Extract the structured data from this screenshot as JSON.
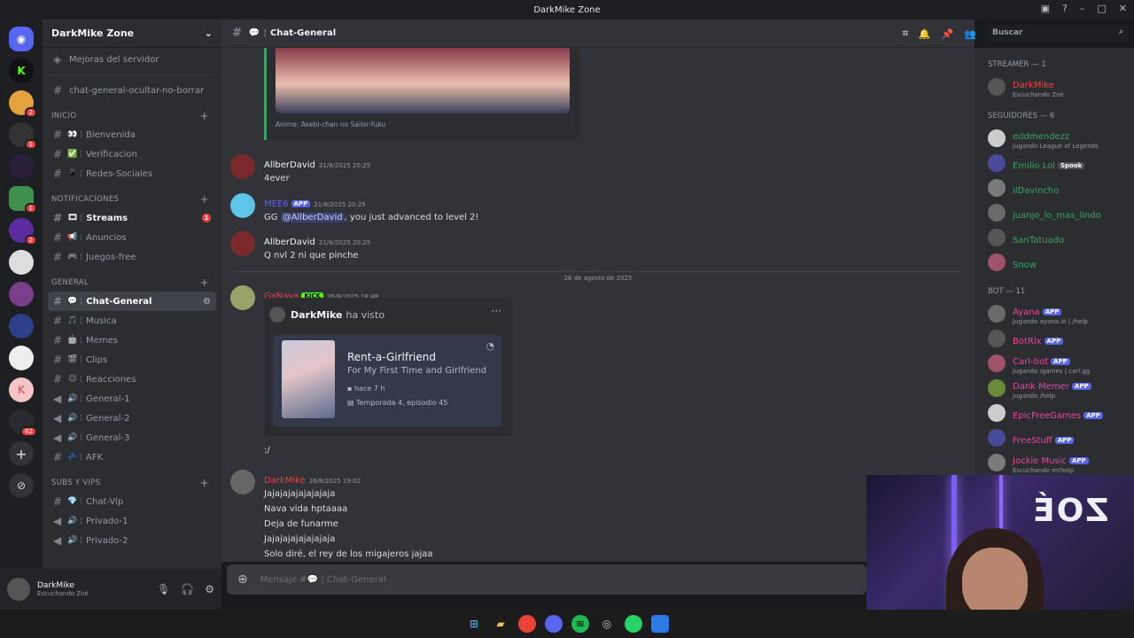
{
  "window": {
    "title": "DarkMike Zone"
  },
  "server_rail": {
    "badges": [
      "2",
      "1",
      "1",
      "2",
      "62"
    ]
  },
  "sidebar": {
    "server_name": "DarkMike Zone",
    "boost": "Mejoras del servidor",
    "top_channel": "chat-general-ocultar-no-borrar",
    "categories": [
      {
        "name": "INICIO",
        "channels": [
          {
            "emoji": "👀",
            "label": "Bienvenida"
          },
          {
            "emoji": "✅",
            "label": "Verificacion"
          },
          {
            "emoji": "📱",
            "label": "Redes-Sociales"
          }
        ]
      },
      {
        "name": "NOTIFICACIONES",
        "channels": [
          {
            "emoji": "🎞",
            "label": "Streams",
            "badge": "1"
          },
          {
            "emoji": "📢",
            "label": "Anuncios"
          },
          {
            "emoji": "🎮",
            "label": "Juegos-free"
          }
        ]
      },
      {
        "name": "GENERAL",
        "channels": [
          {
            "emoji": "💬",
            "label": "Chat-General"
          },
          {
            "emoji": "🎵",
            "label": "Musica"
          },
          {
            "emoji": "🤖",
            "label": "Memes"
          },
          {
            "emoji": "🎬",
            "label": "Clips"
          },
          {
            "emoji": "😊",
            "label": "Reacciones"
          },
          {
            "emoji": "🔊",
            "label": "General-1"
          },
          {
            "emoji": "🔊",
            "label": "General-2"
          },
          {
            "emoji": "🔊",
            "label": "General-3"
          },
          {
            "emoji": "💤",
            "label": "AFK"
          }
        ]
      },
      {
        "name": "SUBS Y VIPS",
        "channels": [
          {
            "emoji": "💎",
            "label": "Chat-Vip"
          },
          {
            "emoji": "🔊",
            "label": "Privado-1"
          },
          {
            "emoji": "🔊",
            "label": "Privado-2"
          }
        ]
      }
    ]
  },
  "user_panel": {
    "name": "DarkMike",
    "status": "Escuchando Zoé"
  },
  "chat": {
    "channel": "Chat-General",
    "search_placeholder": "Buscar",
    "embed_caption": "Anime: Akebi-chan no Sailor-fuku",
    "messages": [
      {
        "author": "AllberDavid",
        "time": "21/8/2025 20:25",
        "text": "4ever"
      },
      {
        "author": "MEE6",
        "tag": "APP",
        "time": "21/8/2025 20:25",
        "pre": "GG ",
        "mention": "@AllberDavid",
        "post": ", you just advanced to level 2!"
      },
      {
        "author": "AllberDavid",
        "time": "21/8/2025 20:25",
        "text": "Q nvl 2 ni que pinche"
      }
    ],
    "date_divider": "26 de agosto de 2025",
    "navi": {
      "author": "GxNava",
      "tag": "KICK",
      "time": "26/8/2025 18:48",
      "embed_user": "DarkMike",
      "embed_action": "ha visto",
      "show_title": "Rent-a-Girlfriend",
      "episode_title": "For My First Time and Girlfriend",
      "ago": "hace 7 h",
      "season": "Temporada 4, episodio 45",
      "after": ":/"
    },
    "mike": {
      "author": "DarkMike",
      "time": "26/8/2025 19:02",
      "lines": [
        "Jajajajajajajajaja",
        "Nava vida hptaaaa",
        "Deja de funarme",
        "Jajajajajajajajaja",
        "Solo diré, el rey de los migajeros jajaa"
      ]
    },
    "input_placeholder": "Mensaje #💬 ¦ Chat-General"
  },
  "members": {
    "sections": [
      {
        "title": "STREAMER — 1",
        "items": [
          {
            "name": "DarkMike",
            "status": "Escuchando Zoé",
            "color": "#f23f43"
          }
        ]
      },
      {
        "title": "SEGUIDORES — 6",
        "items": [
          {
            "name": "eddmendezz",
            "status": "Jugando League of Legends",
            "color": "#3ba55d"
          },
          {
            "name": "Emilio Lol",
            "status": "",
            "color": "#3ba55d",
            "tag": "Spook"
          },
          {
            "name": "ilDavincho",
            "status": "",
            "color": "#3ba55d"
          },
          {
            "name": "juanjo_lo_mas_lindo",
            "status": "",
            "color": "#3ba55d"
          },
          {
            "name": "SanTatuado",
            "status": "",
            "color": "#3ba55d"
          },
          {
            "name": "Snow",
            "status": "",
            "color": "#3ba55d"
          }
        ]
      },
      {
        "title": "BOT — 11",
        "items": [
          {
            "name": "Ayana",
            "status": "Jugando ayana.io | /help",
            "color": "#eb459e",
            "tag": "APP"
          },
          {
            "name": "BotRix",
            "status": "",
            "color": "#eb459e",
            "tag": "APP"
          },
          {
            "name": "Carl-bot",
            "status": "Jugando /games | carl.gg",
            "color": "#eb459e",
            "tag": "APP"
          },
          {
            "name": "Dank Memer",
            "status": "Jugando /help",
            "color": "#eb459e",
            "tag": "APP"
          },
          {
            "name": "EpicFreeGames",
            "status": "",
            "color": "#eb459e",
            "tag": "APP"
          },
          {
            "name": "FreeStuff",
            "status": "",
            "color": "#eb459e",
            "tag": "APP"
          },
          {
            "name": "Jockie Music",
            "status": "Escuchando m!help",
            "color": "#eb459e",
            "tag": "APP"
          }
        ]
      }
    ]
  },
  "webcam": {
    "sign": "ZOÉ"
  }
}
